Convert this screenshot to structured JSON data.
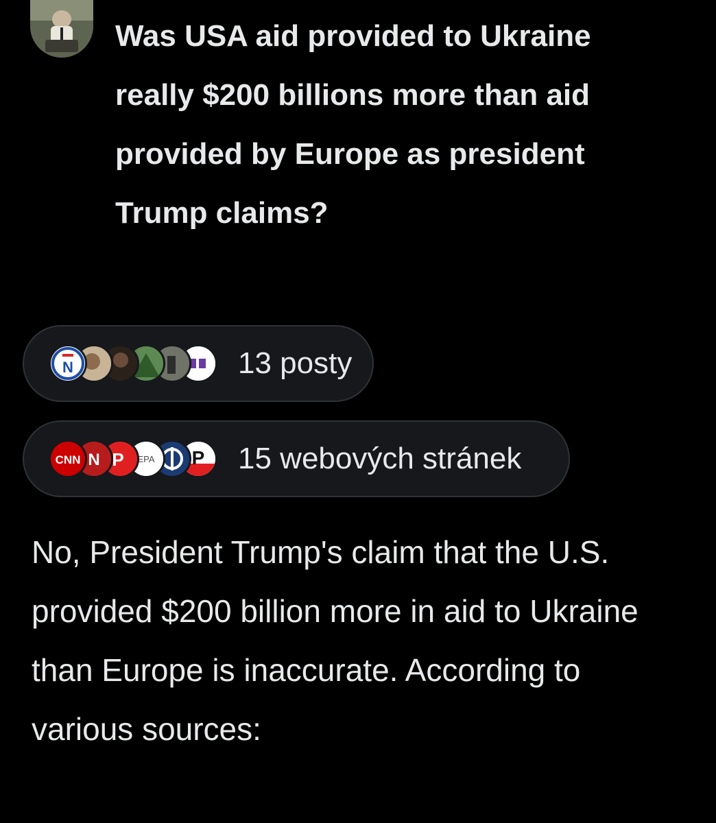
{
  "question": {
    "text": "Was USA aid provided to Ukraine really $200 billions more than aid provided by Europe as president Trump claims?"
  },
  "sources": {
    "posts_label": "13 posty",
    "websites_label": "15 webových stránek",
    "website_icon_texts": [
      "CNN",
      "N",
      "P",
      "EPA",
      "P"
    ]
  },
  "answer": {
    "text": "No, President Trump's claim that the U.S. provided $200 billion more in aid to Ukraine than Europe is inaccurate. According to various sources:"
  },
  "colors": {
    "background": "#000000",
    "text": "#e7e9ea",
    "pill_background": "#16181c",
    "pill_border": "#2f3336"
  }
}
